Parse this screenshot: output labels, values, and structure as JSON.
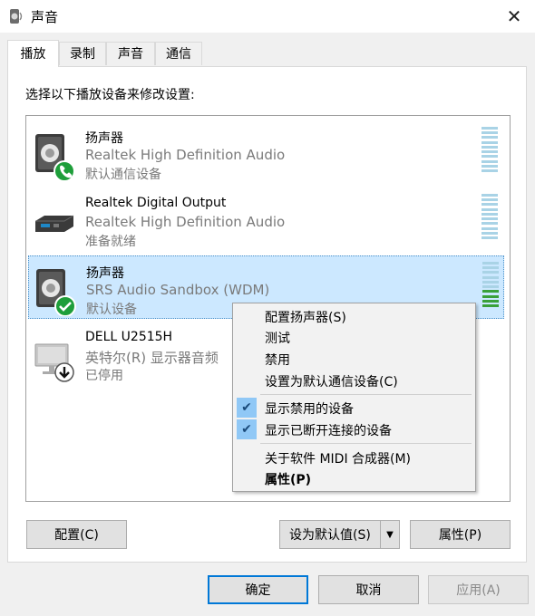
{
  "window": {
    "title": "声音",
    "close_glyph": "✕"
  },
  "tabs": [
    {
      "label": "播放",
      "active": true
    },
    {
      "label": "录制",
      "active": false
    },
    {
      "label": "声音",
      "active": false
    },
    {
      "label": "通信",
      "active": false
    }
  ],
  "instruction": "选择以下播放设备来修改设置:",
  "devices": [
    {
      "name": "扬声器",
      "description": "Realtek High Definition Audio",
      "status": "默认通信设备",
      "icon": "speaker-icon",
      "badge": "phone-badge-icon",
      "meter_level": 0.0
    },
    {
      "name": "Realtek Digital Output",
      "description": "Realtek High Definition Audio",
      "status": "准备就绪",
      "icon": "digital-output-icon",
      "badge": "",
      "meter_level": 0.0
    },
    {
      "name": "扬声器",
      "description": "SRS Audio Sandbox (WDM)",
      "status": "默认设备",
      "icon": "speaker-icon",
      "badge": "check-badge-icon",
      "meter_level": 0.42,
      "selected": true
    },
    {
      "name": "DELL U2515H",
      "description": "英特尔(R) 显示器音频",
      "status": "已停用",
      "icon": "monitor-icon",
      "badge": "down-arrow-badge-icon",
      "meter_level": 0.0
    }
  ],
  "context_menu": {
    "items": [
      {
        "label": "配置扬声器(S)",
        "checked": false,
        "bold": false
      },
      {
        "label": "测试",
        "checked": false,
        "bold": false
      },
      {
        "label": "禁用",
        "checked": false,
        "bold": false
      },
      {
        "label": "设置为默认通信设备(C)",
        "checked": false,
        "bold": false
      },
      {
        "label": "显示禁用的设备",
        "checked": true,
        "bold": false
      },
      {
        "label": "显示已断开连接的设备",
        "checked": true,
        "bold": false
      },
      {
        "label": "关于软件 MIDI 合成器(M)",
        "checked": false,
        "bold": false
      },
      {
        "label": "属性(P)",
        "checked": false,
        "bold": true
      }
    ]
  },
  "panel_buttons": {
    "configure": "配置(C)",
    "set_default": "设为默认值(S)",
    "properties": "属性(P)"
  },
  "dialog_buttons": {
    "ok": "确定",
    "cancel": "取消",
    "apply": "应用(A)"
  },
  "colors": {
    "selection": "#cce8ff",
    "accent": "#0078d7",
    "badge_green": "#1e9e3a",
    "meter_idle": "#a9d3e6",
    "meter_active": "#3aa13a"
  }
}
